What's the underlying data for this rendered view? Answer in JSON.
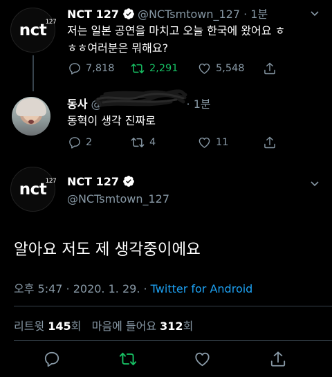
{
  "tweet1": {
    "name": "NCT 127",
    "handle": "@NCTsmtown_127",
    "time": "· 1분",
    "text_line1": "저는 일본 공연을 마치고 오늘 한국에 왔어요 ㅎ",
    "text_line2": "ㅎㅎ여러분은 뭐해요?",
    "replies": "7,818",
    "retweets": "2,291",
    "likes": "5,548",
    "avatar_logo": "nct",
    "avatar_sup": "127"
  },
  "reply": {
    "name": "동사",
    "handle": "@",
    "time": "· 1분",
    "text": "동혁이 생각 진짜로",
    "replies": "2",
    "retweets": "4",
    "likes": "11"
  },
  "main": {
    "name": "NCT 127",
    "handle": "@NCTsmtown_127",
    "text": "알아요 저도 제 생각중이에요",
    "time": "오후 5:47 · 2020. 1. 29. · ",
    "source": "Twitter for Android",
    "stats_retweet_label": "리트윗 ",
    "stats_retweet_count": "145",
    "stats_retweet_unit": "회",
    "stats_like_label": "마음에 들어요 ",
    "stats_like_count": "312",
    "stats_like_unit": "회",
    "avatar_logo": "nct",
    "avatar_sup": "127"
  },
  "colors": {
    "background": "#000000",
    "muted": "#8899a6",
    "retweet_green": "#17bf63",
    "link_blue": "#1da1f2",
    "verified": "#ffffff"
  },
  "icons": [
    "reply-icon",
    "retweet-icon",
    "like-icon",
    "share-icon",
    "verified-icon",
    "chevron-down-icon"
  ]
}
